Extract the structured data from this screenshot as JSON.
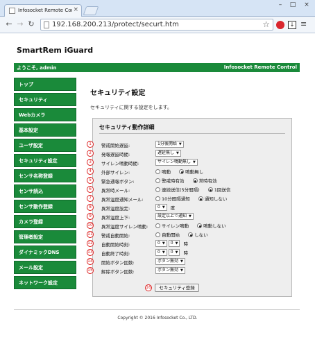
{
  "browser": {
    "tab_title": "Infosocket Remote Con",
    "url": "192.168.200.213/protect/securt.htm"
  },
  "header": {
    "brand": "SmartRem iGuard",
    "welcome": "ようこそ, admin",
    "app_name": "Infosocket Remote Control"
  },
  "sidebar": {
    "items": [
      {
        "label": "トップ"
      },
      {
        "label": "セキュリティ"
      },
      {
        "label": "Webカメラ"
      },
      {
        "label": "基本設定"
      },
      {
        "label": "ユーザ設定"
      },
      {
        "label": "セキュリティ設定"
      },
      {
        "label": "センサ名称登録"
      },
      {
        "label": "センサ読込"
      },
      {
        "label": "センサ動作登録"
      },
      {
        "label": "カメラ登録"
      },
      {
        "label": "管理者設定"
      },
      {
        "label": "ダイナミックDNS"
      },
      {
        "label": "メール設定"
      },
      {
        "label": "ネットワーク設定"
      }
    ]
  },
  "main": {
    "title": "セキュリティ設定",
    "description": "セキュリティに関する設定をします。"
  },
  "panel": {
    "title": "セキュリティ動作詳細",
    "rows": [
      {
        "num": "1",
        "label": "警戒開始遅延:",
        "select": "1分後開始"
      },
      {
        "num": "2",
        "label": "発報遅延時間:",
        "select": "遅延無し"
      },
      {
        "num": "3",
        "label": "サイレン鳴動時間:",
        "select": "サイレン鳴動無し"
      },
      {
        "num": "4",
        "label": "外部サイレン:",
        "opt1": "鳴動",
        "opt2": "鳴動無し"
      },
      {
        "num": "5",
        "label": "緊急通報ボタン:",
        "opt1": "警戒時有効",
        "opt2": "常時有効"
      },
      {
        "num": "6",
        "label": "異常時メール:",
        "opt1": "連続送信(5分間隔)",
        "opt2": "1回送信"
      },
      {
        "num": "7",
        "label": "異常温度通知メール:",
        "opt1": "10分間隔通知",
        "opt2": "通知しない"
      },
      {
        "num": "8",
        "label": "異常温度設定:",
        "select": "0",
        "unit": "度"
      },
      {
        "num": "9",
        "label": "異常温度上下:",
        "select": "設定以上で通知"
      },
      {
        "num": "10",
        "label": "異常温度サイレン鳴動:",
        "opt1": "サイレン鳴動",
        "opt2": "鳴動しない"
      },
      {
        "num": "11",
        "label": "警戒自動開始:",
        "opt1": "自動開始",
        "opt2": "しない"
      },
      {
        "num": "12",
        "label": "自動開始時刻:",
        "select_h": "0",
        "select_m": "0",
        "unit": "時"
      },
      {
        "num": "13",
        "label": "自動終了時刻:",
        "select_h": "0",
        "select_m": "0",
        "unit": "時"
      },
      {
        "num": "14",
        "label": "開始ボタン回数:",
        "select": "ボタン無効"
      },
      {
        "num": "15",
        "label": "解除ボタン回数:",
        "select": "ボタン無効"
      }
    ],
    "submit_num": "16",
    "submit_label": "セキュリティ登録"
  },
  "footer": {
    "copyright": "Copyright © 2016 Infosocket Co., LTD."
  }
}
